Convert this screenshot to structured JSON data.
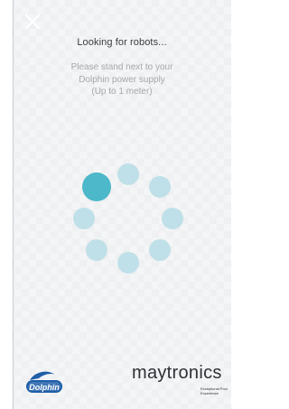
{
  "screen": {
    "title": "Looking for robots...",
    "instructions": [
      "Please stand next to your",
      "Dolphin power supply",
      "(Up to 1 meter)"
    ]
  },
  "spinner": {
    "dot_count": 8,
    "active_dot": 0,
    "active_color": "#4cb8c9",
    "inactive_color": "#bfe0e8"
  },
  "footer": {
    "left_logo": "Dolphin",
    "right_logo": "maytronics",
    "right_logo_tagline": [
      "Exceptional Pool",
      "Experience"
    ]
  },
  "icons": {
    "close": "close-icon"
  }
}
